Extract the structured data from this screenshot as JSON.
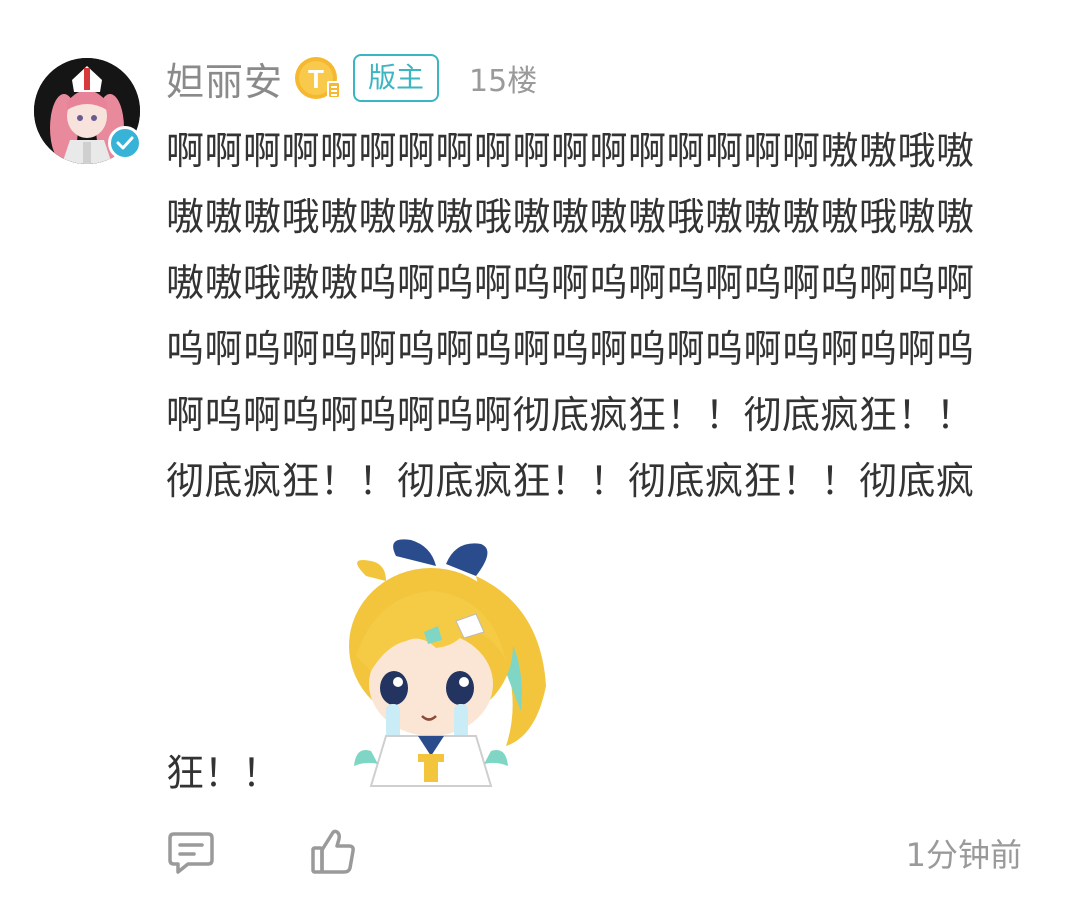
{
  "post": {
    "username": "妲丽安",
    "level_badge_letter": "T",
    "role_badge": "版主",
    "floor": "15楼",
    "content": "啊啊啊啊啊啊啊啊啊啊啊啊啊啊啊啊啊嗷嗷哦嗷嗷嗷嗷哦嗷嗷嗷嗷哦嗷嗷嗷嗷哦嗷嗷嗷嗷哦嗷嗷嗷嗷哦嗷嗷呜啊呜啊呜啊呜啊呜啊呜啊呜啊呜啊呜啊呜啊呜啊呜啊呜啊呜啊呜啊呜啊呜啊呜啊呜啊呜啊呜啊呜啊呜啊彻底疯狂！！彻底疯狂！！彻底疯狂！！彻底疯狂！！彻底疯狂！！彻底疯",
    "content_tail": "狂！！",
    "sticker_name": "crying-girl-sticker",
    "time": "1分钟前"
  },
  "icons": {
    "reply": "comment-icon",
    "like": "thumbs-up-icon",
    "verified": "verified-check-icon"
  },
  "colors": {
    "badge_teal": "#3bb5c2",
    "verified_blue": "#38b3d8",
    "level_gold": "#f5b82e",
    "text_dark": "#333333",
    "text_gray": "#8a8a8a"
  }
}
